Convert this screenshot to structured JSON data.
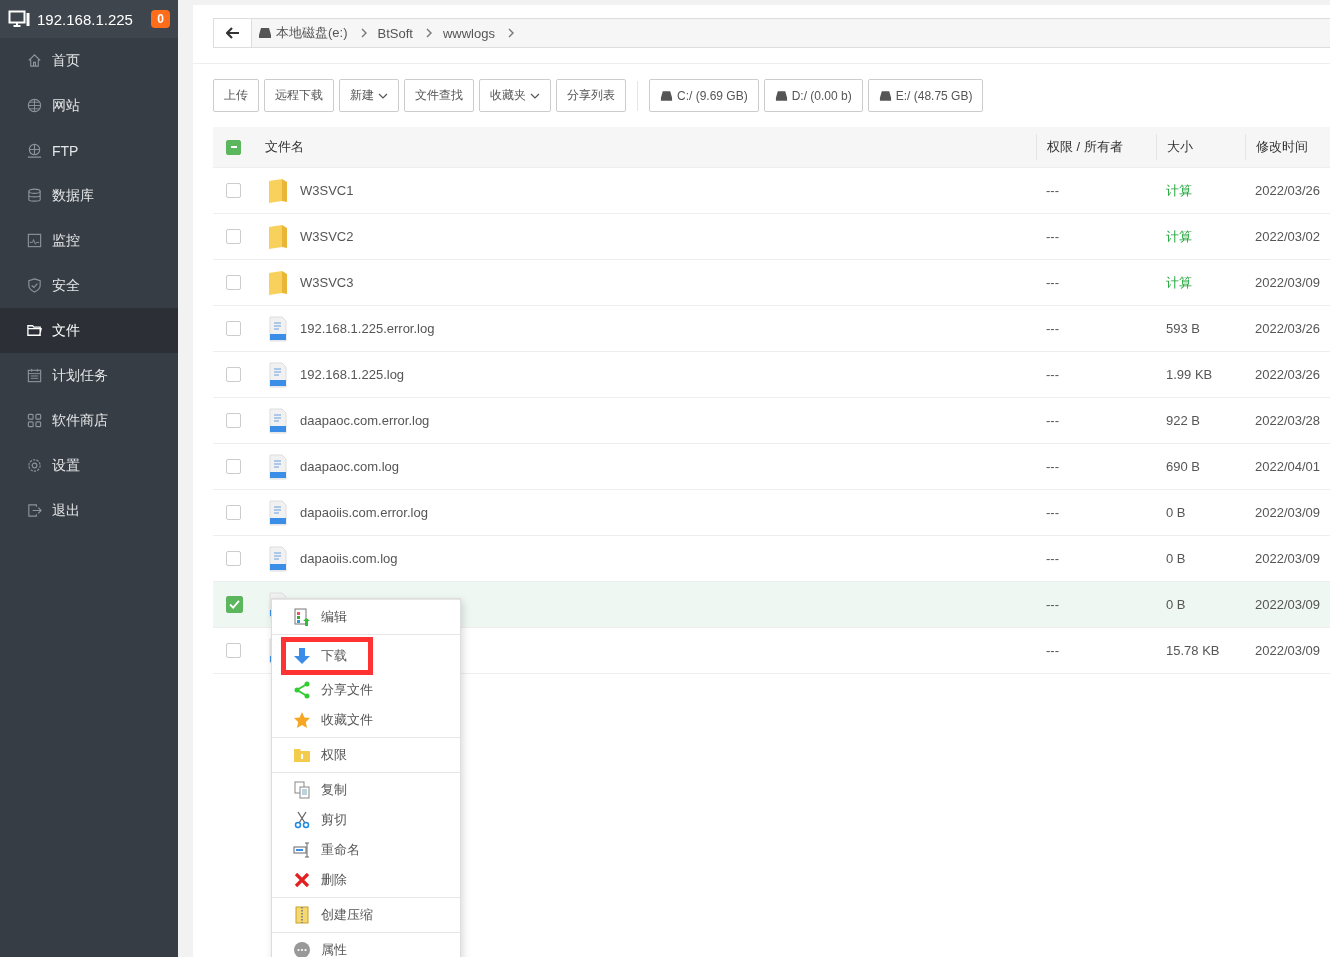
{
  "header": {
    "host": "192.168.1.225",
    "badge": "0"
  },
  "sidebar": {
    "items": [
      {
        "label": "首页",
        "selected": false
      },
      {
        "label": "网站",
        "selected": false
      },
      {
        "label": "FTP",
        "selected": false
      },
      {
        "label": "数据库",
        "selected": false
      },
      {
        "label": "监控",
        "selected": false
      },
      {
        "label": "安全",
        "selected": false
      },
      {
        "label": "文件",
        "selected": true
      },
      {
        "label": "计划任务",
        "selected": false
      },
      {
        "label": "软件商店",
        "selected": false
      },
      {
        "label": "设置",
        "selected": false
      },
      {
        "label": "退出",
        "selected": false
      }
    ]
  },
  "breadcrumb": {
    "path": [
      {
        "label": "本地磁盘(e:)",
        "kind": "drive"
      },
      {
        "label": "BtSoft",
        "kind": "folder"
      },
      {
        "label": "wwwlogs",
        "kind": "folder"
      }
    ]
  },
  "toolbar": {
    "buttons": [
      {
        "label": "上传",
        "dropdown": false
      },
      {
        "label": "远程下载",
        "dropdown": false
      },
      {
        "label": "新建",
        "dropdown": true
      },
      {
        "label": "文件查找",
        "dropdown": false
      },
      {
        "label": "收藏夹",
        "dropdown": true
      },
      {
        "label": "分享列表",
        "dropdown": false
      }
    ],
    "drives": [
      "C:/ (9.69 GB)",
      "D:/ (0.00 b)",
      "E:/ (48.75 GB)"
    ]
  },
  "table": {
    "columns": [
      "文件名",
      "权限 / 所有者",
      "大小",
      "修改时间"
    ],
    "header_indeterminate": true,
    "rows": [
      {
        "kind": "folder",
        "name": "W3SVC1",
        "permissions": "---",
        "size": "计算",
        "modified": "2022/03/26",
        "checked": false
      },
      {
        "kind": "folder",
        "name": "W3SVC2",
        "permissions": "---",
        "size": "计算",
        "modified": "2022/03/02",
        "checked": false
      },
      {
        "kind": "folder",
        "name": "W3SVC3",
        "permissions": "---",
        "size": "计算",
        "modified": "2022/03/09",
        "checked": false
      },
      {
        "kind": "log",
        "name": "192.168.1.225.error.log",
        "permissions": "---",
        "size": "593 B",
        "modified": "2022/03/26",
        "checked": false
      },
      {
        "kind": "log",
        "name": "192.168.1.225.log",
        "permissions": "---",
        "size": "1.99 KB",
        "modified": "2022/03/26",
        "checked": false
      },
      {
        "kind": "log",
        "name": "daapaoc.com.error.log",
        "permissions": "---",
        "size": "922 B",
        "modified": "2022/03/28",
        "checked": false
      },
      {
        "kind": "log",
        "name": "daapaoc.com.log",
        "permissions": "---",
        "size": "690 B",
        "modified": "2022/04/01",
        "checked": false
      },
      {
        "kind": "log",
        "name": "dapaoiis.com.error.log",
        "permissions": "---",
        "size": "0 B",
        "modified": "2022/03/09",
        "checked": false
      },
      {
        "kind": "log",
        "name": "dapaoiis.com.log",
        "permissions": "---",
        "size": "0 B",
        "modified": "2022/03/09",
        "checked": false
      },
      {
        "kind": "log",
        "permissions": "---",
        "size": "0 B",
        "modified": "2022/03/09",
        "checked": true
      },
      {
        "kind": "log",
        "permissions": "---",
        "size": "15.78 KB",
        "modified": "2022/03/09",
        "checked": false
      }
    ]
  },
  "context_menu": {
    "groups": [
      [
        {
          "label": "编辑",
          "highlighted": false
        }
      ],
      [
        {
          "label": "下载",
          "highlighted": true
        },
        {
          "label": "分享文件",
          "highlighted": false
        },
        {
          "label": "收藏文件",
          "highlighted": false
        }
      ],
      [
        {
          "label": "权限",
          "highlighted": false
        }
      ],
      [
        {
          "label": "复制",
          "highlighted": false
        },
        {
          "label": "剪切",
          "highlighted": false
        },
        {
          "label": "重命名",
          "highlighted": false
        },
        {
          "label": "删除",
          "highlighted": false
        }
      ],
      [
        {
          "label": "创建压缩",
          "highlighted": false
        }
      ],
      [
        {
          "label": "属性",
          "highlighted": false
        }
      ]
    ]
  }
}
